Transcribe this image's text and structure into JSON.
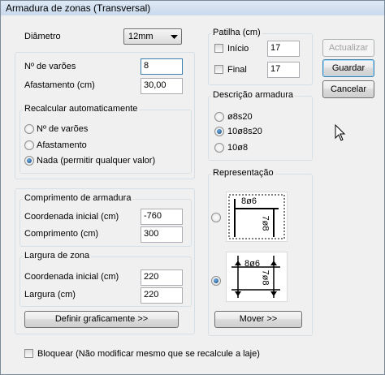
{
  "window": {
    "title": "Armadura de zonas (Transversal)"
  },
  "diametro": {
    "label": "Diâmetro",
    "value": "12mm"
  },
  "numero": {
    "n_varoes_label": "Nº de varões",
    "n_varoes_value": "8",
    "afastamento_label": "Afastamento (cm)",
    "afastamento_value": "30,00"
  },
  "recalcular": {
    "legend": "Recalcular automaticamente",
    "options": [
      "Nº de varões",
      "Afastamento",
      "Nada (permitir qualquer valor)"
    ],
    "selected": 2
  },
  "comprimento": {
    "legend": "Comprimento de armadura",
    "coord_label": "Coordenada inicial (cm)",
    "coord_value": "-760",
    "comp_label": "Comprimento (cm)",
    "comp_value": "300"
  },
  "largura": {
    "legend": "Largura de zona",
    "coord_label": "Coordenada inicial (cm)",
    "coord_value": "220",
    "larg_label": "Largura (cm)",
    "larg_value": "220"
  },
  "definir_button": "Definir graficamente >>",
  "patilha": {
    "legend": "Patilha (cm)",
    "inicio_label": "Início",
    "inicio_value": "17",
    "final_label": "Final",
    "final_value": "17"
  },
  "descricao": {
    "legend": "Descrição armadura",
    "options": [
      "ø8s20",
      "10ø8s20",
      "10ø8"
    ],
    "selected": 1
  },
  "representacao": {
    "legend": "Representação",
    "preview1_text": [
      "8ø6",
      "7ø8"
    ],
    "preview2_text": [
      "8ø6",
      "7ø8"
    ],
    "selected": 1
  },
  "mover_button": "Mover >>",
  "actions": {
    "actualizar": "Actualizar",
    "guardar": "Guardar",
    "cancelar": "Cancelar"
  },
  "bloquear": {
    "label": "Bloquear (Não modificar mesmo que se recalcule a laje)"
  }
}
